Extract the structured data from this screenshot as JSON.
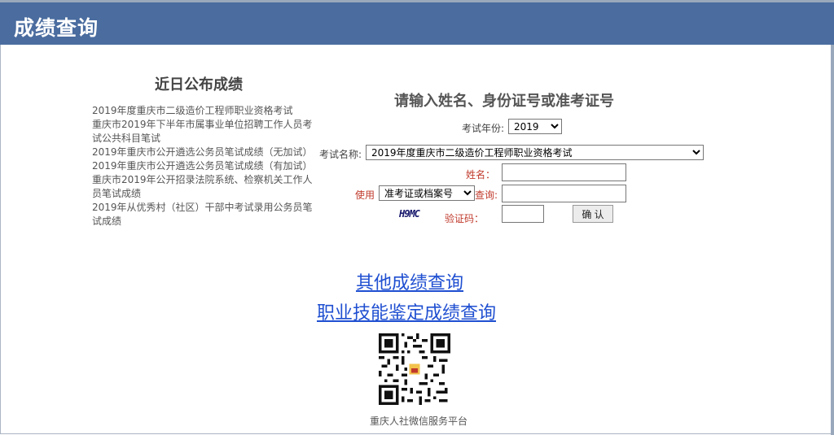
{
  "header": {
    "title": "成绩查询"
  },
  "recent": {
    "title": "近日公布成绩",
    "items": [
      "2019年度重庆市二级造价工程师职业资格考试",
      "重庆市2019年下半年市属事业单位招聘工作人员考试公共科目笔试",
      "2019年重庆市公开遴选公务员笔试成绩（无加试）",
      "2019年重庆市公开遴选公务员笔试成绩（有加试）",
      "重庆市2019年公开招录法院系统、检察机关工作人员笔试成绩",
      "2019年从优秀村（社区）干部中考试录用公务员笔试成绩"
    ]
  },
  "form": {
    "title": "请输入姓名、身份证号或准考证号",
    "year_label": "考试年份:",
    "year_value": "2019",
    "exam_label": "考试名称:",
    "exam_value": "2019年度重庆市二级造价工程师职业资格考试",
    "name_label": "姓名：",
    "use_label": "使用",
    "id_type_value": "准考证或档案号",
    "query_label": "查询:",
    "captcha_label": "验证码：",
    "captcha_text": "H9MC",
    "confirm_button": "确 认"
  },
  "links": {
    "other": "其他成绩查询",
    "skills": "职业技能鉴定成绩查询"
  },
  "qr": {
    "caption": "重庆人社微信服务平台"
  },
  "colors": {
    "header_bg": "#4a6c9f",
    "link": "#1f4fd1",
    "label_red": "#c0392b"
  }
}
